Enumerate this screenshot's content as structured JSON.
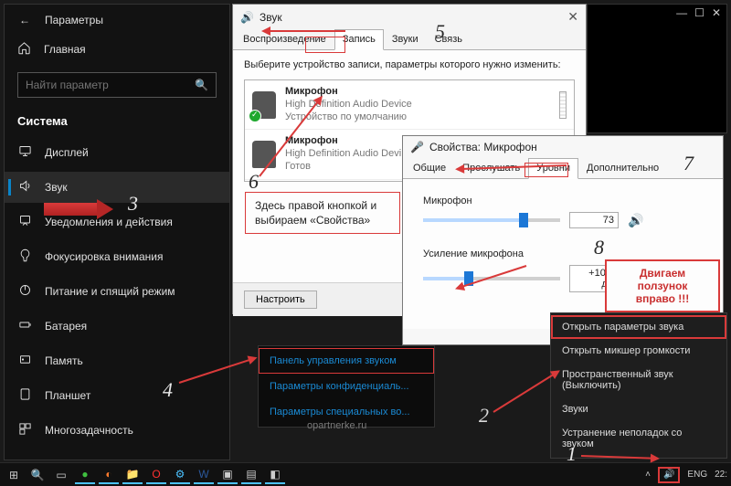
{
  "settings": {
    "title": "Параметры",
    "home": "Главная",
    "search_placeholder": "Найти параметр",
    "section": "Система",
    "items": [
      {
        "label": "Дисплей"
      },
      {
        "label": "Звук"
      },
      {
        "label": "Уведомления и действия"
      },
      {
        "label": "Фокусировка внимания"
      },
      {
        "label": "Питание и спящий режим"
      },
      {
        "label": "Батарея"
      },
      {
        "label": "Память"
      },
      {
        "label": "Планшет"
      },
      {
        "label": "Многозадачность"
      }
    ]
  },
  "sound": {
    "title": "Звук",
    "tabs": [
      "Воспроизведение",
      "Запись",
      "Звуки",
      "Связь"
    ],
    "instr": "Выберите устройство записи, параметры которого нужно изменить:",
    "devices": [
      {
        "name": "Микрофон",
        "sub1": "High Definition Audio Device",
        "sub2": "Устройство по умолчанию"
      },
      {
        "name": "Микрофон",
        "sub1": "High Definition Audio Devi",
        "sub2": "Готов"
      }
    ],
    "configure": "Настроить"
  },
  "mic": {
    "title": "Свойства: Микрофон",
    "tabs": [
      "Общие",
      "Прослушать",
      "Уровни",
      "Дополнительно"
    ],
    "ctl1": {
      "label": "Микрофон",
      "value": "73"
    },
    "ctl2": {
      "label": "Усиление микрофона",
      "value": "+10.0 дБ"
    }
  },
  "ctx": {
    "items": [
      "Открыть параметры звука",
      "Открыть микшер громкости",
      "Пространственный звук (Выключить)",
      "Звуки",
      "Устранение неполадок со звуком"
    ]
  },
  "mid_links": [
    "Панель управления звуком",
    "Параметры конфиденциаль...",
    "Параметры специальных во..."
  ],
  "watermark": "opartnerke.ru",
  "taskbar": {
    "lang": "ENG",
    "time": "22:"
  },
  "anno": {
    "rightclick_a": "Здесь правой кнопкой и",
    "rightclick_b": "выбираем «Свойства»",
    "slider_a": "Двигаем ползунок",
    "slider_b": "вправо !!!",
    "n1": "1",
    "n2": "2",
    "n3": "3",
    "n4": "4",
    "n5": "5",
    "n6": "6",
    "n7": "7",
    "n8": "8"
  }
}
